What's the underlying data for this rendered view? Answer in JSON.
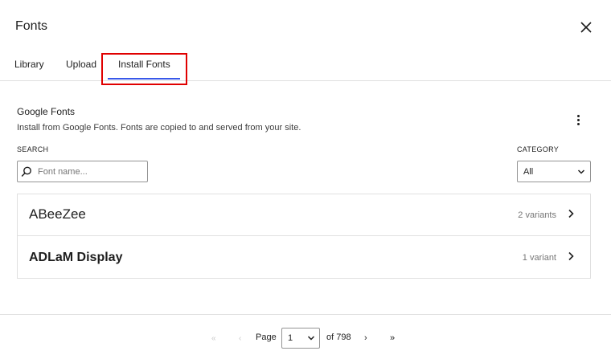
{
  "dialog": {
    "title": "Fonts",
    "close_icon": "close-icon"
  },
  "tabs": [
    {
      "label": "Library"
    },
    {
      "label": "Upload"
    },
    {
      "label": "Install Fonts",
      "active": true
    }
  ],
  "highlight_color": "#e00000",
  "accent_color": "#3858e9",
  "collection": {
    "title": "Google Fonts",
    "description": "Install from Google Fonts. Fonts are copied to and served from your site.",
    "more_icon": "more-vertical-icon"
  },
  "filters": {
    "search_label": "SEARCH",
    "search_placeholder": "Font name...",
    "search_value": "",
    "search_icon": "search-icon",
    "category_label": "CATEGORY",
    "category_value": "All"
  },
  "fonts": [
    {
      "name": "ABeeZee",
      "variants": "2 variants"
    },
    {
      "name": "ADLaM Display",
      "variants": "1 variant"
    }
  ],
  "pagination": {
    "first": "«",
    "prev": "‹",
    "page_label": "Page",
    "current_page": "1",
    "of_label": "of 798",
    "next": "›",
    "last": "»"
  }
}
